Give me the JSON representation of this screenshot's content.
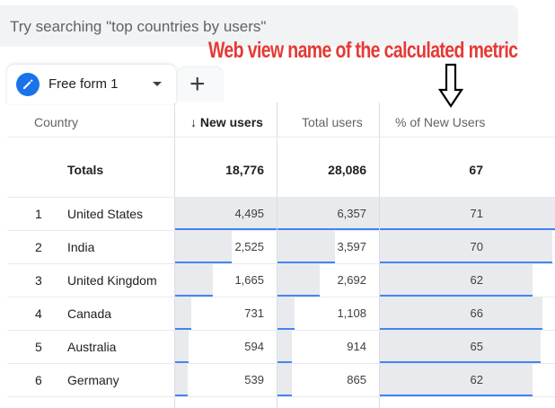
{
  "search": {
    "placeholder": "Try searching \"top countries by users\""
  },
  "annotation": {
    "text": "Web view name of the calculated metric"
  },
  "tabs": {
    "active_label": "Free form 1",
    "add_label": "+"
  },
  "table": {
    "columns": {
      "country": "Country",
      "new_users": "New users",
      "sort_indicator": "↓",
      "total_users": "Total users",
      "pct_new_users": "% of New Users"
    },
    "totals": {
      "label": "Totals",
      "new_users": "18,776",
      "total_users": "28,086",
      "pct_new_users": "67"
    },
    "rows": [
      {
        "rank": "1",
        "country": "United States",
        "new_users": "4,495",
        "total_users": "6,357",
        "pct": "71",
        "nu_frac": 1.0,
        "tu_frac": 1.0,
        "pct_frac": 1.0
      },
      {
        "rank": "2",
        "country": "India",
        "new_users": "2,525",
        "total_users": "3,597",
        "pct": "70",
        "nu_frac": 0.56,
        "tu_frac": 0.57,
        "pct_frac": 0.985
      },
      {
        "rank": "3",
        "country": "United Kingdom",
        "new_users": "1,665",
        "total_users": "2,692",
        "pct": "62",
        "nu_frac": 0.37,
        "tu_frac": 0.42,
        "pct_frac": 0.87
      },
      {
        "rank": "4",
        "country": "Canada",
        "new_users": "731",
        "total_users": "1,108",
        "pct": "66",
        "nu_frac": 0.16,
        "tu_frac": 0.17,
        "pct_frac": 0.93
      },
      {
        "rank": "5",
        "country": "Australia",
        "new_users": "594",
        "total_users": "914",
        "pct": "65",
        "nu_frac": 0.13,
        "tu_frac": 0.14,
        "pct_frac": 0.92
      },
      {
        "rank": "6",
        "country": "Germany",
        "new_users": "539",
        "total_users": "865",
        "pct": "62",
        "nu_frac": 0.12,
        "tu_frac": 0.14,
        "pct_frac": 0.87
      }
    ]
  },
  "colors": {
    "accent": "#1a73e8",
    "bar": "#4285f4",
    "bar_fill": "#e8eaed",
    "annotation": "#e53935"
  }
}
